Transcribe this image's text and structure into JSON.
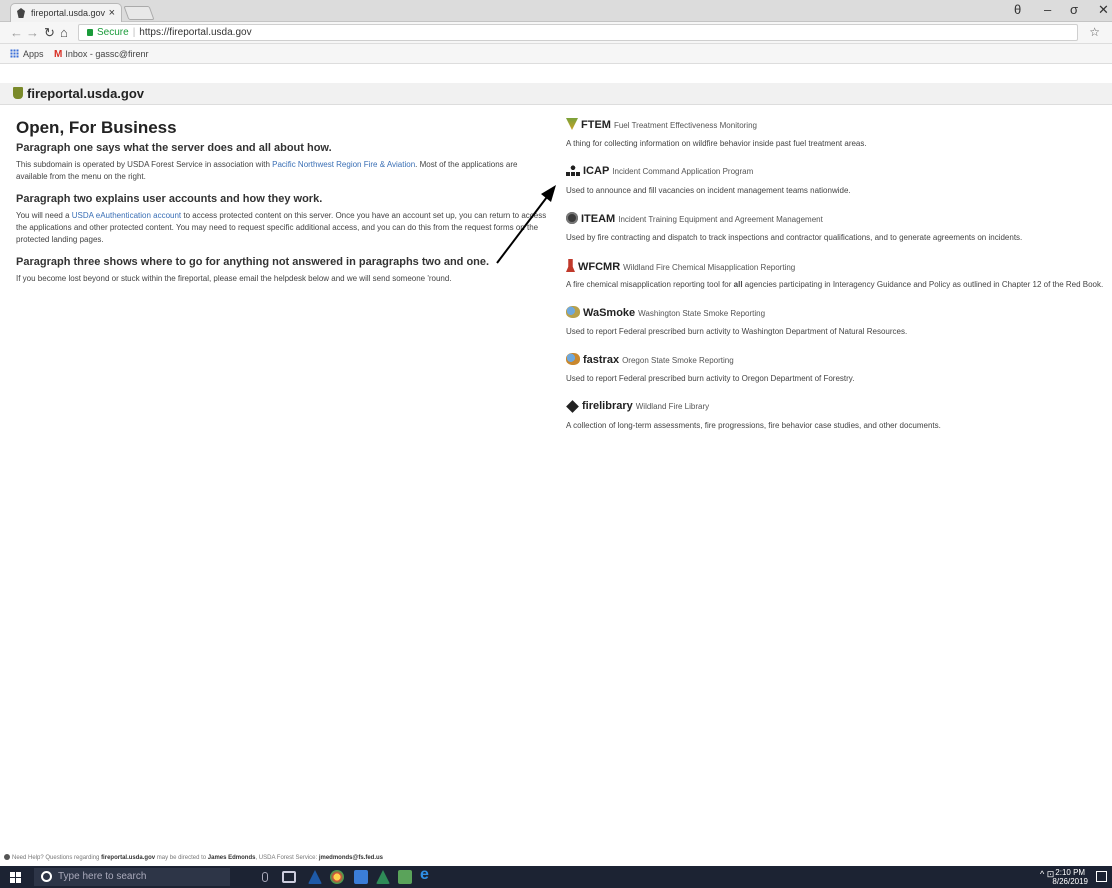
{
  "browser": {
    "tab_title": "fireportal.usda.gov",
    "tab_close": "×",
    "address": {
      "secure_label": "Secure",
      "url": "https://fireportal.usda.gov"
    },
    "bookmarks": {
      "apps_label": "Apps",
      "inbox_label": "Inbox - gassc@firenr"
    },
    "window_controls": [
      "θ",
      "–",
      "σ",
      "✕"
    ]
  },
  "site": {
    "title": "fireportal.usda.gov"
  },
  "left": {
    "heading": "Open, For Business",
    "p1_title": "Paragraph one says what the server does and all about how.",
    "p1_text_a": "This subdomain is operated by USDA Forest Service in association with ",
    "p1_link": "Pacific Northwest Region Fire & Aviation",
    "p1_text_b": ". Most of the applications are available from the menu on the right.",
    "p2_title": "Paragraph two explains user accounts and how they work.",
    "p2_text_a": "You will need a ",
    "p2_link": "USDA eAuthentication account",
    "p2_text_b": " to access protected content on this server. Once you have an account set up, you can return to access the applications and other protected content. You may need to request specific additional access, and you can do this from the request forms on the protected landing pages.",
    "p3_title": "Paragraph three shows where to go for anything not answered in paragraphs two and one.",
    "p3_text": "If you become lost beyond or stuck within the fireportal, please email the helpdesk below and we will send someone 'round."
  },
  "apps": [
    {
      "name": "FTEM",
      "full": "Fuel Treatment Effectiveness Monitoring",
      "desc": "A thing for collecting information on wildfire behavior inside past fuel treatment areas."
    },
    {
      "name": "ICAP",
      "full": "Incident Command Application Program",
      "desc": "Used to announce and fill vacancies on incident management teams nationwide."
    },
    {
      "name": "ITEAM",
      "full": "Incident Training Equipment and Agreement Management",
      "desc": "Used by fire contracting and dispatch to track inspections and contractor qualifications, and to generate agreements on incidents."
    },
    {
      "name": "WFCMR",
      "full": "Wildland Fire Chemical Misapplication Reporting",
      "desc_a": "A fire chemical misapplication reporting tool for ",
      "desc_bold": "all",
      "desc_b": " agencies participating in Interagency Guidance and Policy as outlined in Chapter 12 of the Red Book."
    },
    {
      "name": "WaSmoke",
      "full": "Washington State Smoke Reporting",
      "desc": "Used to report Federal prescribed burn activity to Washington Department of Natural Resources."
    },
    {
      "name": "fastrax",
      "full": "Oregon State Smoke Reporting",
      "desc": "Used to report Federal prescribed burn activity to Oregon Department of Forestry."
    },
    {
      "name": "firelibrary",
      "full": "Wildland Fire Library",
      "desc": "A collection of long-term assessments, fire progressions, fire behavior case studies, and other documents."
    }
  ],
  "footer": {
    "a": "Need Help? Questions regarding ",
    "b_bold": "fireportal.usda.gov",
    "c": " may be directed to ",
    "d_bold": "James Edmonds",
    "e": ", USDA Forest Service: ",
    "f_bold": "jmedmonds@fs.fed.us"
  },
  "taskbar": {
    "search_placeholder": "Type here to search",
    "time": "2:10 PM",
    "date": "8/26/2019",
    "tray_text": "^ ⊡"
  },
  "colors": {
    "link": "#3a6fb5",
    "secure": "#1a9b3a",
    "taskbar": "#1c2333"
  }
}
